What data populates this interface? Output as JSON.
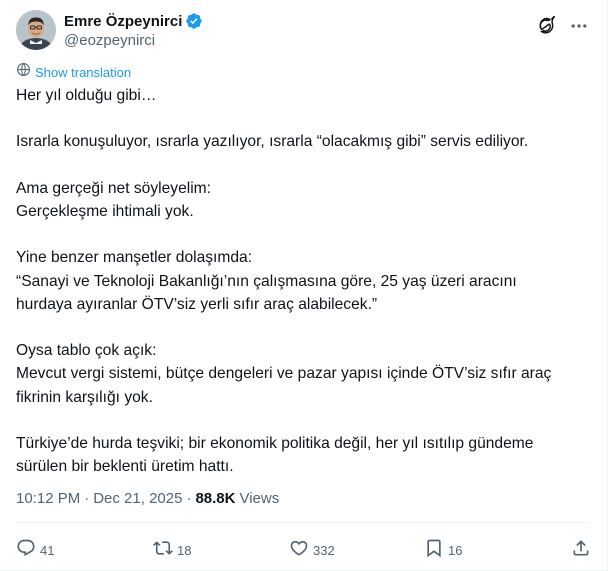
{
  "author": {
    "display_name": "Emre Özpeynirci",
    "handle": "@eozpeynirci",
    "verified": true
  },
  "translate_label": "Show translation",
  "body_paragraphs": [
    [
      "Her yıl olduğu gibi…"
    ],
    [
      "Israrla konuşuluyor, ısrarla yazılıyor, ısrarla “olacakmış gibi” servis ediliyor."
    ],
    [
      "Ama gerçeği net söyleyelim:",
      "Gerçekleşme ihtimali yok."
    ],
    [
      "Yine benzer manşetler dolaşımda:",
      "“Sanayi ve Teknoloji Bakanlığı’nın çalışmasına göre, 25 yaş üzeri aracını",
      "hurdaya ayıranlar ÖTV’siz yerli sıfır araç alabilecek.”"
    ],
    [
      "Oysa tablo çok açık:",
      "Mevcut vergi sistemi, bütçe dengeleri ve pazar yapısı içinde ÖTV’siz sıfır araç",
      "fikrinin karşılığı yok."
    ],
    [
      "Türkiye’de hurda teşviki; bir ekonomik politika değil, her yıl ısıtılıp gündeme",
      "sürülen bir beklenti üretim hattı."
    ]
  ],
  "meta": {
    "time": "10:12 PM",
    "separator": "·",
    "date": "Dec 21, 2025",
    "views_count": "88.8K",
    "views_label": "Views"
  },
  "actions": {
    "replies": "41",
    "reposts": "18",
    "likes": "332",
    "bookmarks": "16"
  },
  "icons": {
    "verified": "verified-badge-icon",
    "grok": "grok-icon",
    "more": "more-icon",
    "translate": "globe-icon",
    "reply": "reply-icon",
    "repost": "repost-icon",
    "like": "heart-icon",
    "bookmark": "bookmark-icon",
    "share": "share-icon"
  },
  "colors": {
    "accent": "#1d9bf0",
    "text": "#0f1419",
    "secondary": "#536471"
  }
}
